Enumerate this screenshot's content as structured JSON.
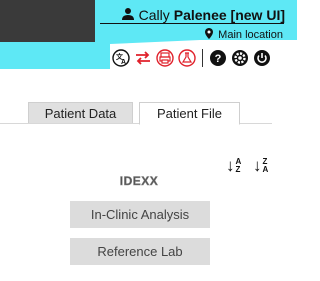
{
  "header": {
    "user_icon": "user-icon",
    "user_name": "Cally",
    "practice": "Palenee [new UI]",
    "location_icon": "map-pin-icon",
    "location": "Main location",
    "colors": {
      "dark": "#3a3a3a",
      "cyan": "#5ee8f5",
      "red": "#e0212b"
    }
  },
  "toolbar": {
    "icons": [
      "translate-icon",
      "swap-arrows-icon",
      "printer-icon",
      "lab-flask-icon",
      "help-icon",
      "settings-icon",
      "power-icon"
    ]
  },
  "tabs": [
    {
      "label": "Patient Data",
      "active": false
    },
    {
      "label": "Patient File",
      "active": true
    }
  ],
  "sort": {
    "asc": {
      "top": "A",
      "bottom": "Z"
    },
    "desc": {
      "top": "Z",
      "bottom": "A"
    }
  },
  "logo": {
    "text": "IDEXX"
  },
  "buttons": {
    "in_clinic": "In-Clinic Analysis",
    "reference_lab": "Reference Lab"
  }
}
